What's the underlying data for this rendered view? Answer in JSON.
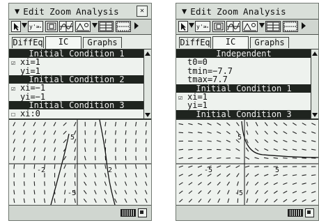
{
  "menubar": {
    "chevron": "▼",
    "items": [
      "Edit",
      "Zoom",
      "Analysis"
    ],
    "close": "✕"
  },
  "tabs": [
    "DiffEq",
    "IC",
    "Graphs"
  ],
  "active_tab": "IC",
  "screen1": {
    "list": [
      {
        "type": "header",
        "text": "Initial Condition 1"
      },
      {
        "type": "row",
        "text": "xi=1",
        "check": "☑"
      },
      {
        "type": "row",
        "text": "yi=1"
      },
      {
        "type": "header",
        "text": "Initial Condition 2"
      },
      {
        "type": "row",
        "text": "xi=−1",
        "check": "☑"
      },
      {
        "type": "row",
        "text": "yi=−1"
      },
      {
        "type": "header",
        "text": "Initial Condition 3"
      },
      {
        "type": "row",
        "text": "xi:0",
        "check": "☐"
      }
    ],
    "graph_labels": {
      "y_top": "5",
      "y_bottom": "-5",
      "x_left": "-2",
      "x_right": "2"
    }
  },
  "screen2": {
    "list": [
      {
        "type": "header",
        "text": "Independent"
      },
      {
        "type": "row",
        "text": "t0=0"
      },
      {
        "type": "row",
        "text": "tmin=−7.7"
      },
      {
        "type": "row",
        "text": "tmax=7.7"
      },
      {
        "type": "header",
        "text": "Initial Condition 1"
      },
      {
        "type": "row",
        "text": "xi=1",
        "check": "☑"
      },
      {
        "type": "row",
        "text": "yi=1"
      },
      {
        "type": "header",
        "text": "Initial Condition 3"
      }
    ],
    "graph_labels": {
      "y_top": "5",
      "y_bottom": "-5",
      "x_left": "-5",
      "x_right": "5"
    }
  }
}
